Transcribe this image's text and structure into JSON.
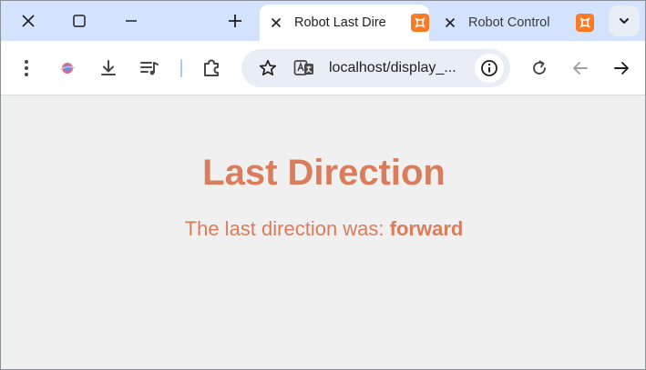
{
  "browser": {
    "tabs": [
      {
        "title": "Robot Last Dire",
        "active": true,
        "favicon": "xampp-icon"
      },
      {
        "title": "Robot Control",
        "active": false,
        "favicon": "xampp-icon"
      }
    ],
    "address_bar": {
      "url": "localhost/display_..."
    },
    "colors": {
      "tabstrip": "#d3e3fd",
      "toolbar": "#ffffff",
      "omnibox": "#e9eef6",
      "accent_separator": "#a8c7fa",
      "xampp_orange": "#fb7a24"
    },
    "icons": {
      "window_controls": [
        "close-icon",
        "maximize-icon",
        "minimize-icon"
      ],
      "new_tab": "plus-icon",
      "toolbar": [
        "menu-dots-icon",
        "extension-avatar-icon",
        "download-icon",
        "media-queue-icon",
        "extensions-puzzle-icon"
      ],
      "omnibox": [
        "bookmark-star-icon",
        "translate-icon",
        "site-info-icon"
      ],
      "navigation": [
        "reload-icon",
        "back-arrow-icon",
        "forward-arrow-icon"
      ]
    }
  },
  "page": {
    "heading": "Last Direction",
    "message_prefix": "The last direction was:",
    "direction_value": "forward",
    "text_color": "#da7d5c",
    "background": "#f0f0f0"
  }
}
